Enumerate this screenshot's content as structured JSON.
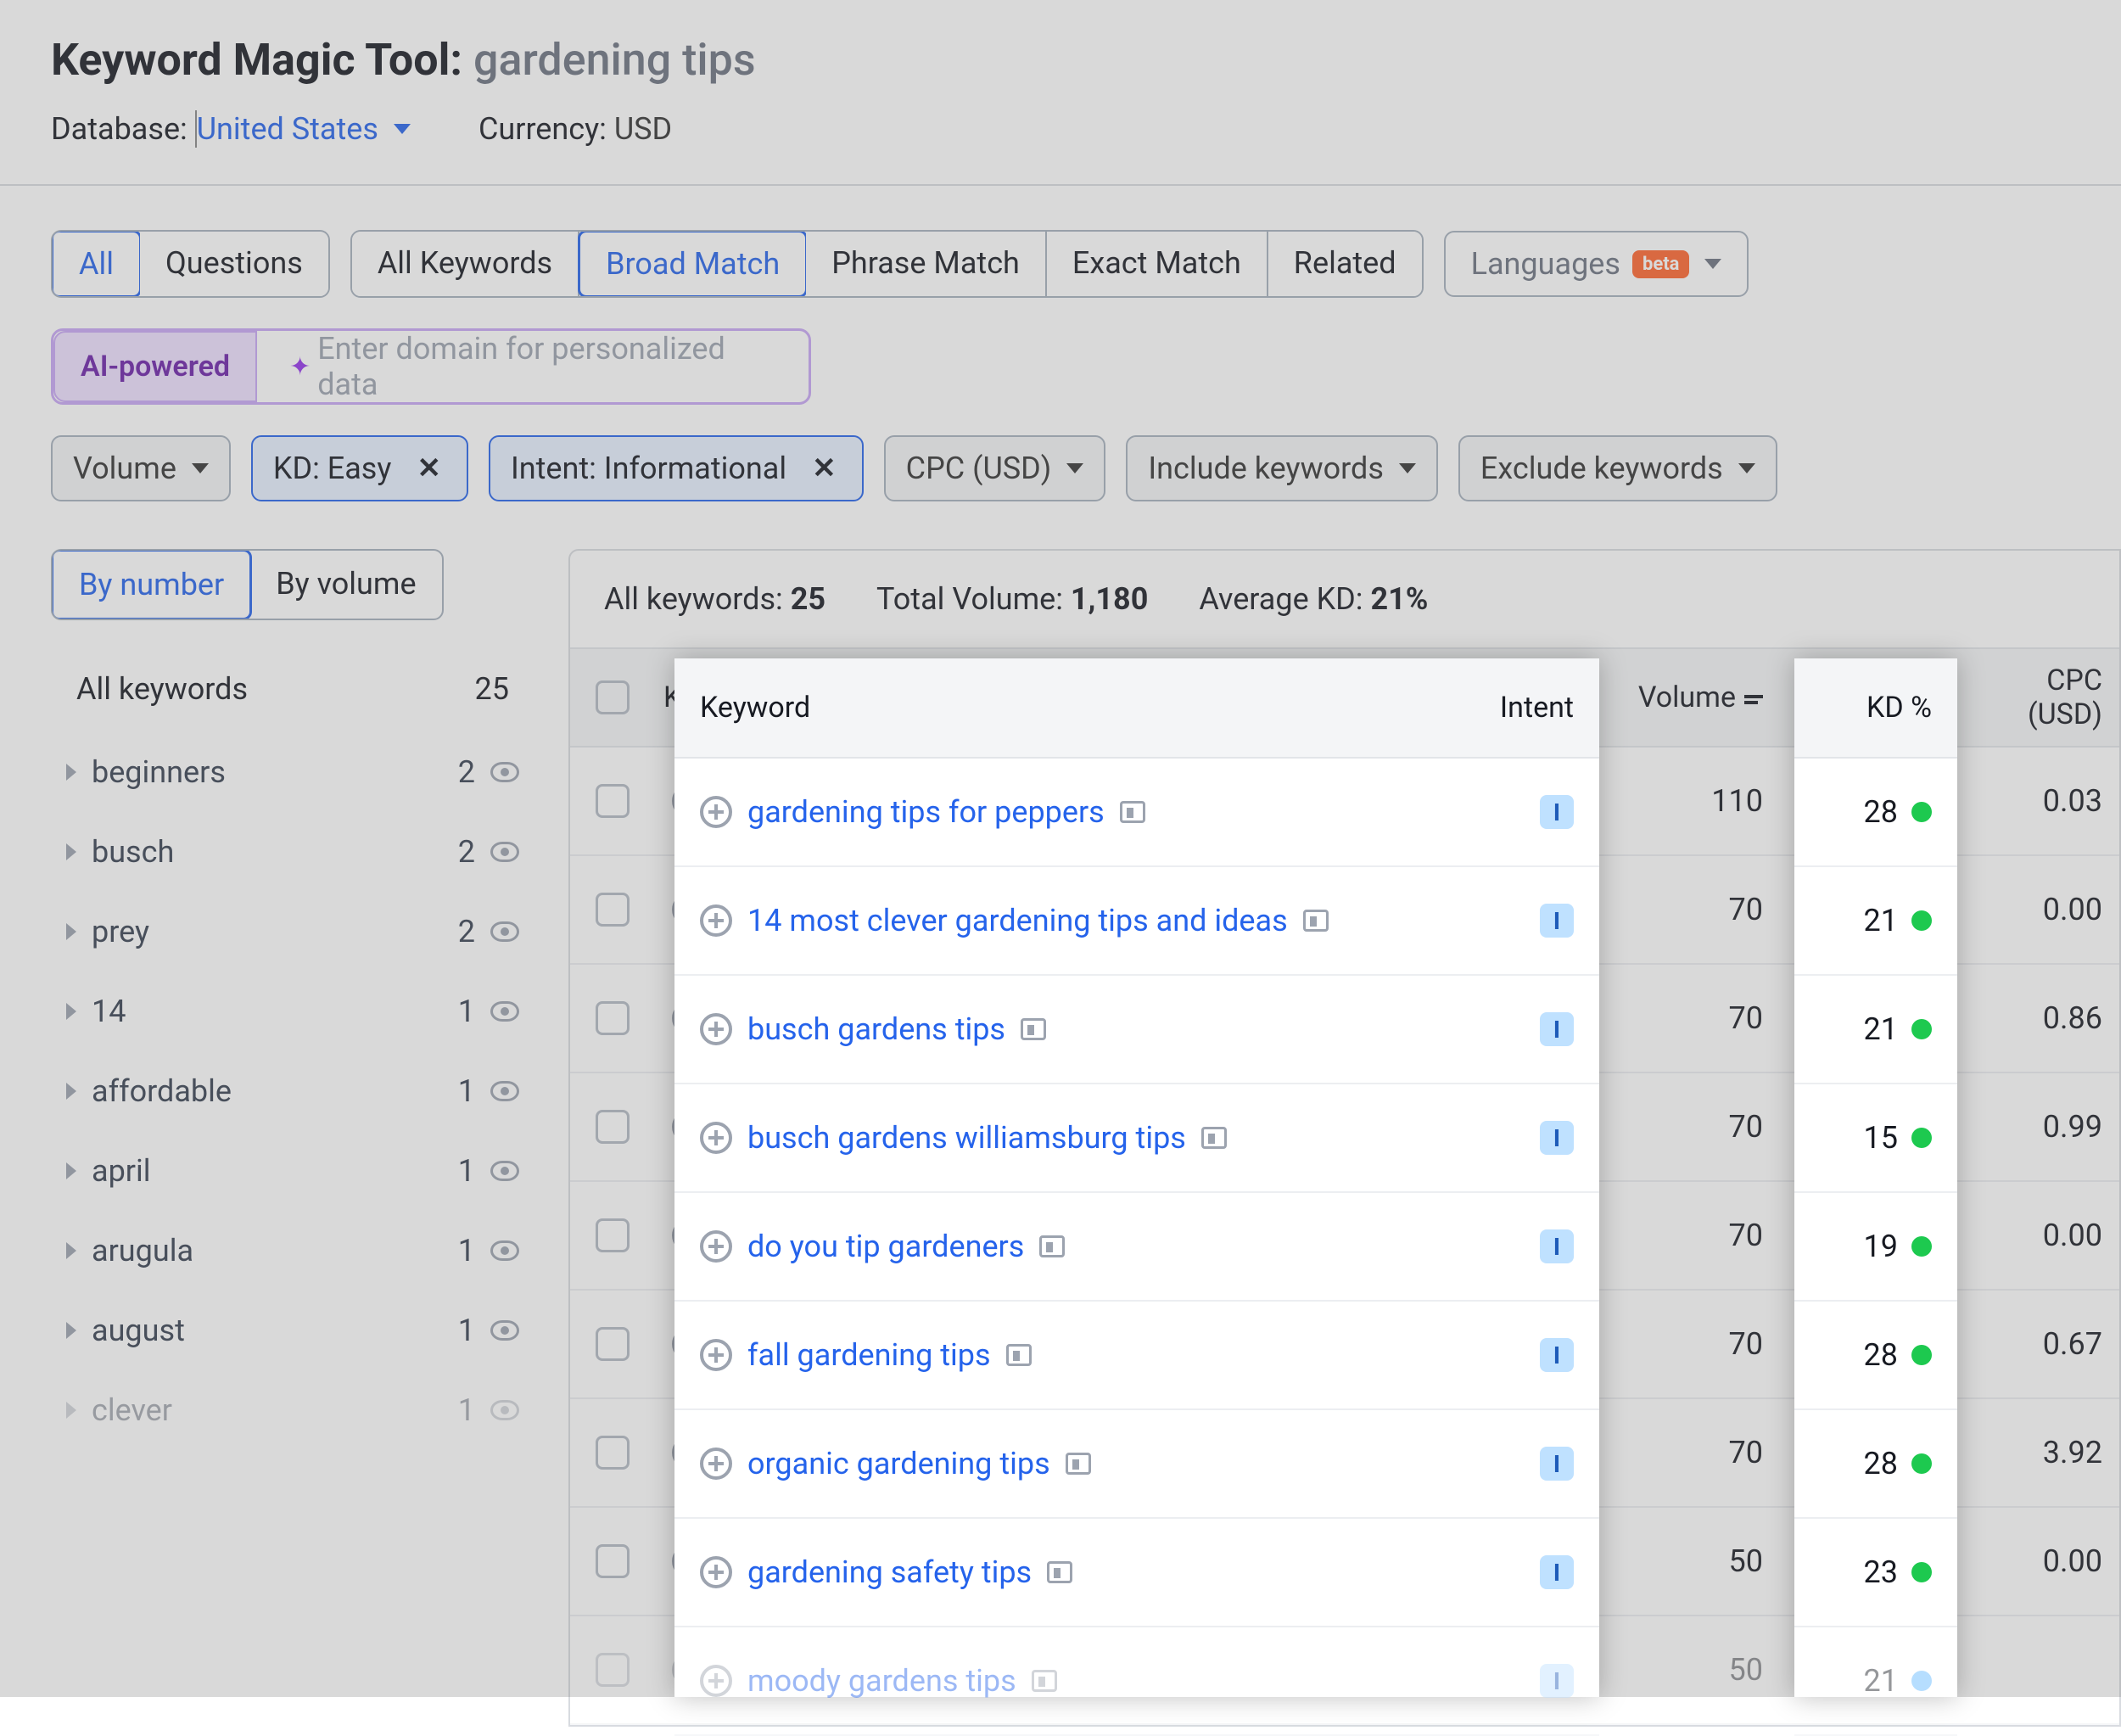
{
  "header": {
    "tool_name": "Keyword Magic Tool:",
    "query": "gardening tips",
    "database_label": "Database:",
    "database_value": "United States",
    "currency_label": "Currency:",
    "currency_value": "USD"
  },
  "tabs_primary": {
    "all": "All",
    "questions": "Questions"
  },
  "tabs_match": {
    "all_keywords": "All Keywords",
    "broad": "Broad Match",
    "phrase": "Phrase Match",
    "exact": "Exact Match",
    "related": "Related"
  },
  "languages_btn": {
    "label": "Languages",
    "badge": "beta"
  },
  "ai": {
    "chip": "AI-powered",
    "placeholder": "Enter domain for personalized data"
  },
  "filters": {
    "volume": "Volume",
    "kd": "KD: Easy",
    "intent": "Intent: Informational",
    "cpc": "CPC (USD)",
    "include": "Include keywords",
    "exclude": "Exclude keywords"
  },
  "sidebar": {
    "tab_number": "By number",
    "tab_volume": "By volume",
    "all_label": "All keywords",
    "all_count": "25",
    "items": [
      {
        "label": "beginners",
        "count": "2"
      },
      {
        "label": "busch",
        "count": "2"
      },
      {
        "label": "prey",
        "count": "2"
      },
      {
        "label": "14",
        "count": "1"
      },
      {
        "label": "affordable",
        "count": "1"
      },
      {
        "label": "april",
        "count": "1"
      },
      {
        "label": "arugula",
        "count": "1"
      },
      {
        "label": "august",
        "count": "1"
      },
      {
        "label": "clever",
        "count": "1"
      }
    ]
  },
  "summary": {
    "all_label": "All keywords:",
    "all_value": "25",
    "vol_label": "Total Volume:",
    "vol_value": "1,180",
    "kd_label": "Average KD:",
    "kd_value": "21%"
  },
  "columns": {
    "keyword": "Keyword",
    "intent": "Intent",
    "volume": "Volume",
    "kd": "KD %",
    "cpc": "CPC (USD)"
  },
  "rows": [
    {
      "keyword": "gardening tips for peppers",
      "intent": "I",
      "volume": "110",
      "kd": "28",
      "kd_color": "green",
      "cpc": "0.03"
    },
    {
      "keyword": "14 most clever gardening tips and ideas",
      "intent": "I",
      "volume": "70",
      "kd": "21",
      "kd_color": "green",
      "cpc": "0.00"
    },
    {
      "keyword": "busch gardens tips",
      "intent": "I",
      "volume": "70",
      "kd": "21",
      "kd_color": "green",
      "cpc": "0.86"
    },
    {
      "keyword": "busch gardens williamsburg tips",
      "intent": "I",
      "volume": "70",
      "kd": "15",
      "kd_color": "green",
      "cpc": "0.99"
    },
    {
      "keyword": "do you tip gardeners",
      "intent": "I",
      "volume": "70",
      "kd": "19",
      "kd_color": "green",
      "cpc": "0.00"
    },
    {
      "keyword": "fall gardening tips",
      "intent": "I",
      "volume": "70",
      "kd": "28",
      "kd_color": "green",
      "cpc": "0.67"
    },
    {
      "keyword": "organic gardening tips",
      "intent": "I",
      "volume": "70",
      "kd": "28",
      "kd_color": "green",
      "cpc": "3.92"
    },
    {
      "keyword": "gardening safety tips",
      "intent": "I",
      "volume": "50",
      "kd": "23",
      "kd_color": "green",
      "cpc": "0.00"
    },
    {
      "keyword": "moody gardens tips",
      "intent": "I",
      "volume": "50",
      "kd": "21",
      "kd_color": "blue",
      "cpc": ""
    }
  ]
}
